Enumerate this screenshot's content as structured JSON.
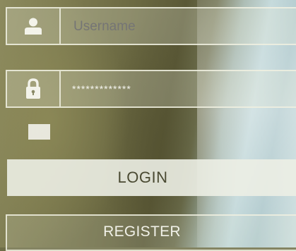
{
  "login_form": {
    "username": {
      "icon": "user-icon",
      "placeholder": "Username"
    },
    "password": {
      "icon": "lock-icon",
      "value": "*************"
    },
    "remember_checkbox": {
      "checked": false
    },
    "login_label": "LOGIN",
    "register_label": "REGISTER"
  },
  "colors": {
    "field_border": "#f0f0e1",
    "login_button_bg": "#eceee4",
    "login_text": "#4a4a32",
    "register_text": "#f8f8f0"
  }
}
